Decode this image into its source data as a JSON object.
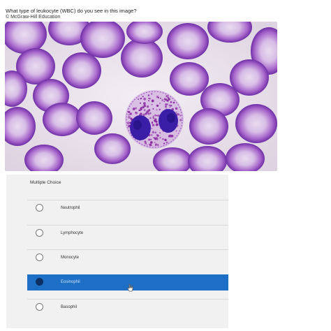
{
  "question": {
    "text": "What type of leukocyte (WBC) do you see in this image?",
    "copyright": "© McGraw-Hill Education"
  },
  "image": {
    "subject": "blood smear micrograph",
    "cell_colors": {
      "rbc_fill": "#bf8fd6",
      "rbc_rim": "#7a3eb0",
      "rbc_center": "#e6d6ee",
      "background": "#ece4ee",
      "wbc_granules": "#8a2aa0",
      "wbc_nucleus": "#3a1ea8"
    }
  },
  "choice_section": {
    "heading": "Multiple Choice",
    "selected_color": "#1c6fc4",
    "options": [
      {
        "label": "Neutrophil",
        "selected": false
      },
      {
        "label": "Lymphocyte",
        "selected": false
      },
      {
        "label": "Monocyte",
        "selected": false
      },
      {
        "label": "Eosinophil",
        "selected": true
      },
      {
        "label": "Basophil",
        "selected": false
      }
    ]
  }
}
